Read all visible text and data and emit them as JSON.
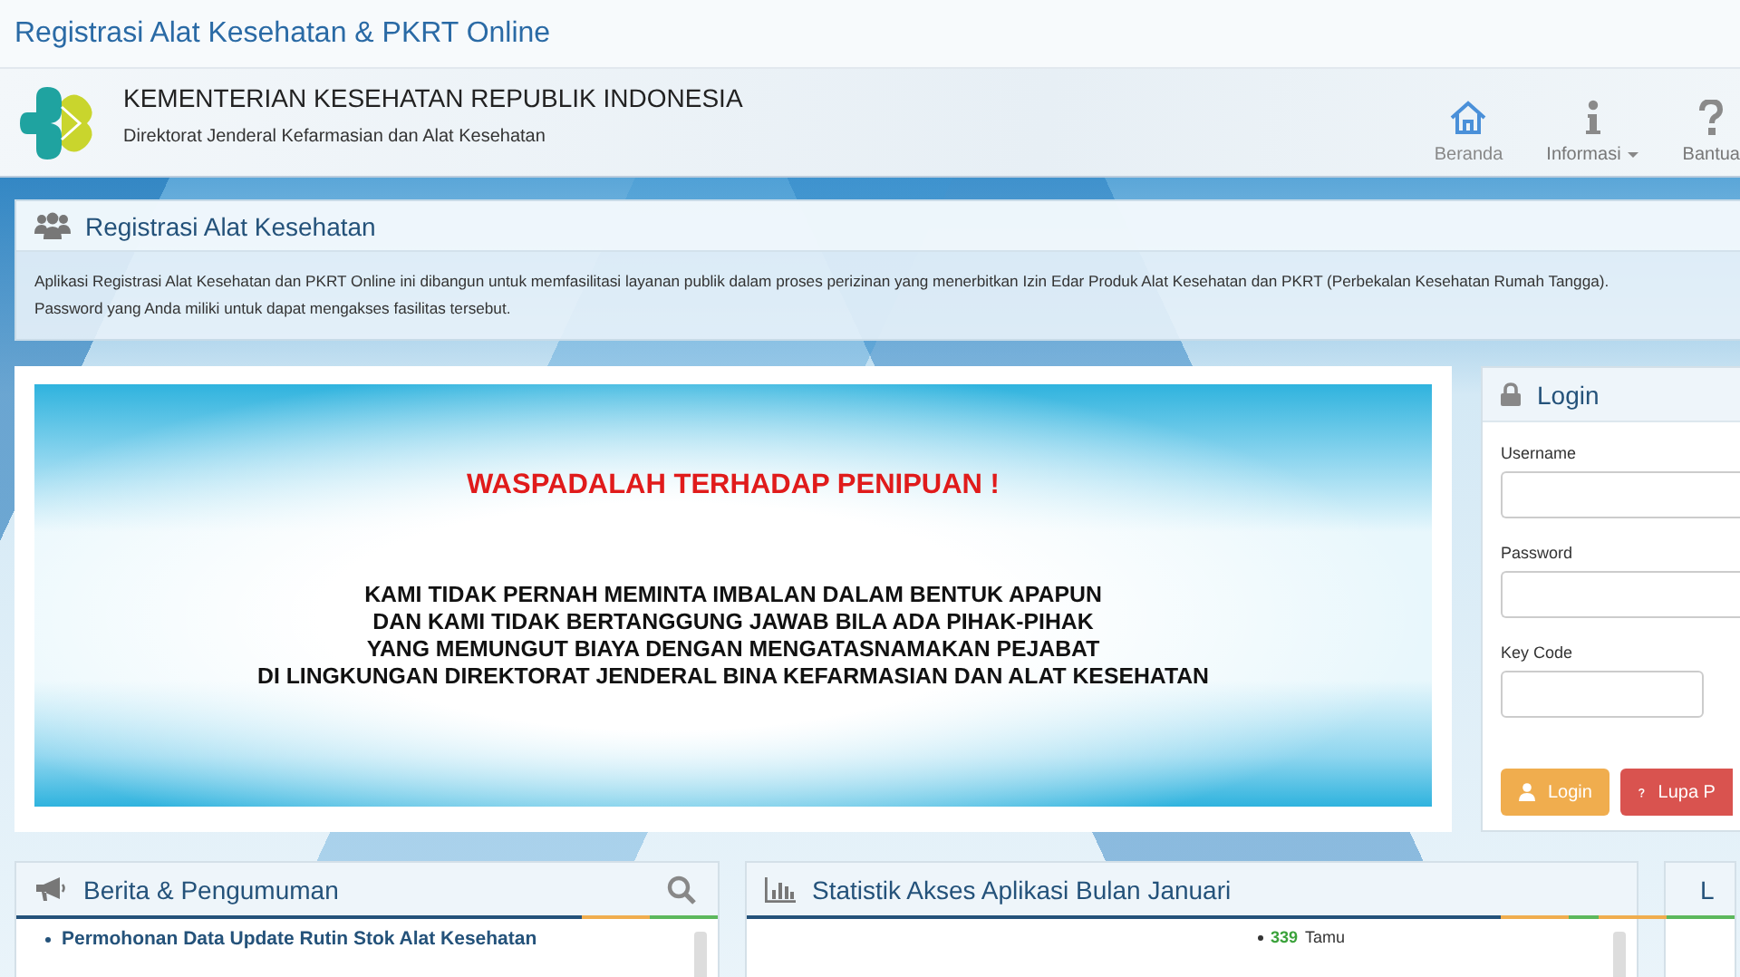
{
  "window": {
    "title": "Registrasi Alat Kesehatan & PKRT Online"
  },
  "header": {
    "org": "KEMENTERIAN KESEHATAN REPUBLIK INDONESIA",
    "subtitle": "Direktorat Jenderal Kefarmasian dan Alat Kesehatan",
    "nav": [
      {
        "label": "Beranda",
        "kind": "home",
        "selected": true,
        "dropdown": false
      },
      {
        "label": "Informasi",
        "kind": "info",
        "selected": false,
        "dropdown": true
      },
      {
        "label": "Bantua",
        "kind": "help",
        "selected": false,
        "dropdown": false
      }
    ]
  },
  "intro": {
    "title": "Registrasi Alat Kesehatan",
    "lines": [
      "Aplikasi Registrasi Alat Kesehatan dan PKRT Online ini dibangun untuk memfasilitasi layanan publik dalam proses perizinan yang menerbitkan Izin Edar Produk Alat Kesehatan dan PKRT (Perbekalan Kesehatan Rumah Tangga).",
      "Password yang Anda miliki untuk dapat mengakses fasilitas tersebut."
    ]
  },
  "banner": {
    "headline": "WASPADALAH TERHADAP PENIPUAN !",
    "lines": [
      "KAMI TIDAK PERNAH MEMINTA IMBALAN DALAM BENTUK APAPUN",
      "DAN KAMI TIDAK BERTANGGUNG JAWAB BILA ADA PIHAK-PIHAK",
      "YANG MEMUNGUT BIAYA DENGAN MENGATASNAMAKAN PEJABAT",
      "DI LINGKUNGAN DIREKTORAT JENDERAL BINA KEFARMASIAN DAN ALAT KESEHATAN"
    ]
  },
  "login": {
    "title": "Login",
    "fields": [
      {
        "label": "Username",
        "kind": "wide"
      },
      {
        "label": "Password",
        "kind": "wide"
      },
      {
        "label": "Key Code",
        "kind": "short"
      }
    ],
    "buttons": [
      {
        "label": "Login",
        "kind": "primary"
      },
      {
        "label": "Lupa P",
        "kind": "danger"
      }
    ]
  },
  "news": {
    "title": "Berita & Pengumuman",
    "items": [
      "Permohonan Data Update Rutin Stok Alat Kesehatan"
    ]
  },
  "stats": {
    "title": "Statistik Akses Aplikasi Bulan Januari",
    "items": [
      {
        "count": "339",
        "label": "Tamu"
      }
    ]
  },
  "links": {
    "title": "L"
  }
}
